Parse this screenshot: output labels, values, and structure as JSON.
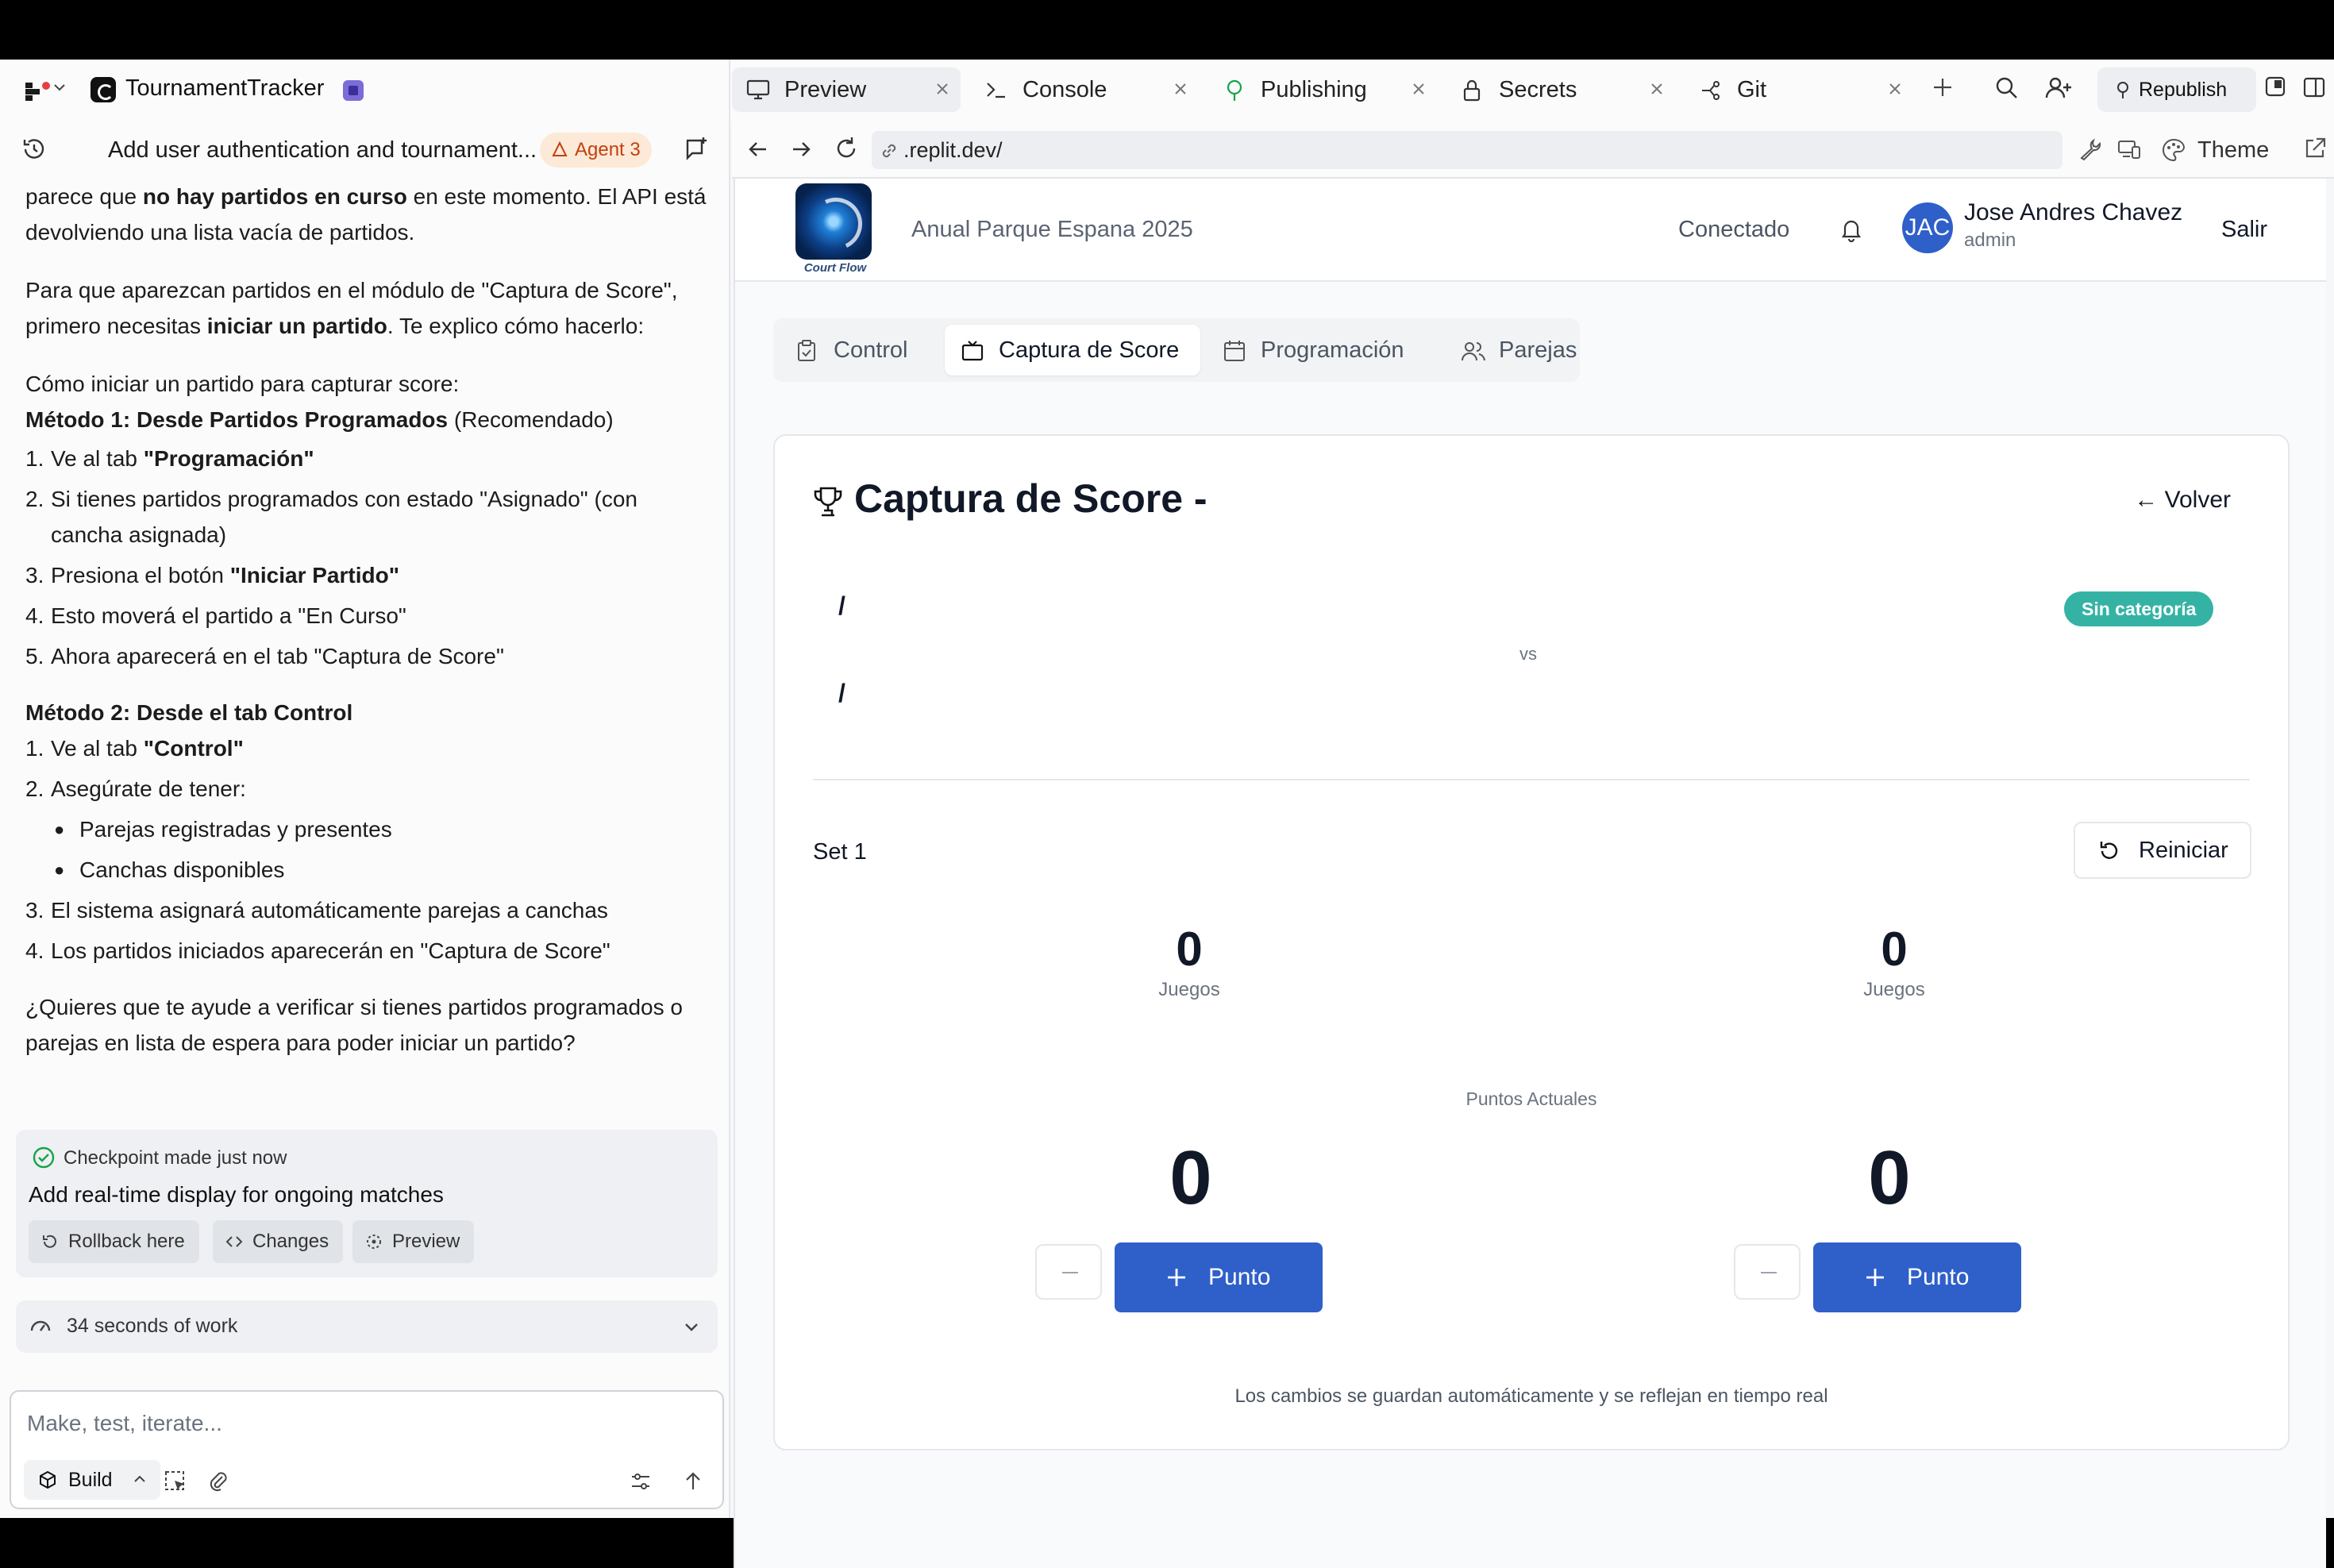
{
  "project": {
    "name": "TournamentTracker"
  },
  "thread": {
    "title": "Add user authentication and tournament...",
    "agent_badge": "Agent 3"
  },
  "chat": {
    "p1_a": "parece que ",
    "p1_b": "no hay partidos en curso",
    "p1_c": " en este momento. El API está devolviendo una lista vacía de partidos.",
    "p2_a": "Para que aparezcan partidos en el módulo de \"Captura de Score\", primero necesitas ",
    "p2_b": "iniciar un partido",
    "p2_c": ". Te explico cómo hacerlo:",
    "how": "Cómo iniciar un partido para capturar score:",
    "m1_b": "Método 1: Desde Partidos Programados",
    "m1_c": " (Recomendado)",
    "m1_steps": [
      {
        "n": "1.",
        "a": "Ve al tab ",
        "b": "\"Programación\"",
        "c": ""
      },
      {
        "n": "2.",
        "a": "Si tienes partidos programados con estado \"Asignado\" (con cancha asignada)",
        "b": "",
        "c": ""
      },
      {
        "n": "3.",
        "a": "Presiona el botón ",
        "b": "\"Iniciar Partido\"",
        "c": ""
      },
      {
        "n": "4.",
        "a": "Esto moverá el partido a \"En Curso\"",
        "b": "",
        "c": ""
      },
      {
        "n": "5.",
        "a": "Ahora aparecerá en el tab \"Captura de Score\"",
        "b": "",
        "c": ""
      }
    ],
    "m2": "Método 2: Desde el tab Control",
    "m2_s1_n": "1.",
    "m2_s1_a": "Ve al tab ",
    "m2_s1_b": "\"Control\"",
    "m2_s2_n": "2.",
    "m2_s2": "Asegúrate de tener:",
    "bullets": [
      "Parejas registradas y presentes",
      "Canchas disponibles"
    ],
    "m2_s3_n": "3.",
    "m2_s3": "El sistema asignará automáticamente parejas a canchas",
    "m2_s4_n": "4.",
    "m2_s4": "Los partidos iniciados aparecerán en \"Captura de Score\"",
    "question": "¿Quieres que te ayude a verificar si tienes partidos programados o parejas en lista de espera para poder iniciar un partido?"
  },
  "checkpoint": {
    "title": "Checkpoint made just now",
    "message": "Add real-time display for ongoing matches",
    "rollback": "Rollback here",
    "changes": "Changes",
    "preview": "Preview"
  },
  "work": {
    "label": "34 seconds of work"
  },
  "composer": {
    "placeholder": "Make, test, iterate...",
    "mode": "Build"
  },
  "tabs": [
    {
      "label": "Preview"
    },
    {
      "label": "Console"
    },
    {
      "label": "Publishing"
    },
    {
      "label": "Secrets"
    },
    {
      "label": "Git"
    }
  ],
  "toolbar": {
    "republish": "Republish",
    "theme": "Theme"
  },
  "url": {
    "value": ".replit.dev/"
  },
  "site": {
    "logo_text": "Court Flow",
    "tournament": "Anual Parque Espana 2025",
    "status": "Conectado",
    "avatar_initials": "JAC",
    "user_name": "Jose Andres Chavez",
    "user_role": "admin",
    "logout": "Salir"
  },
  "nav": [
    {
      "label": "Control",
      "active": false
    },
    {
      "label": "Captura de Score",
      "active": true
    },
    {
      "label": "Programación",
      "active": false
    },
    {
      "label": "Parejas",
      "active": false
    }
  ],
  "score": {
    "title": "Captura de Score -",
    "back": "← Volver",
    "team1": "/",
    "team2": "/",
    "vs": "vs",
    "category": "Sin categoría",
    "set_label": "Set 1",
    "reset": "Reiniciar",
    "games_left": "0",
    "games_right": "0",
    "games_label": "Juegos",
    "current_points_label": "Puntos Actuales",
    "points_left": "0",
    "points_right": "0",
    "point_button": "Punto",
    "autosave_note": "Los cambios se guardan automáticamente y se reflejan en tiempo real"
  },
  "colors": {
    "primary": "#2f5fc9",
    "category_badge": "#34b3a5",
    "agent_badge_bg": "#fde9d7",
    "agent_badge_fg": "#c2410c"
  }
}
